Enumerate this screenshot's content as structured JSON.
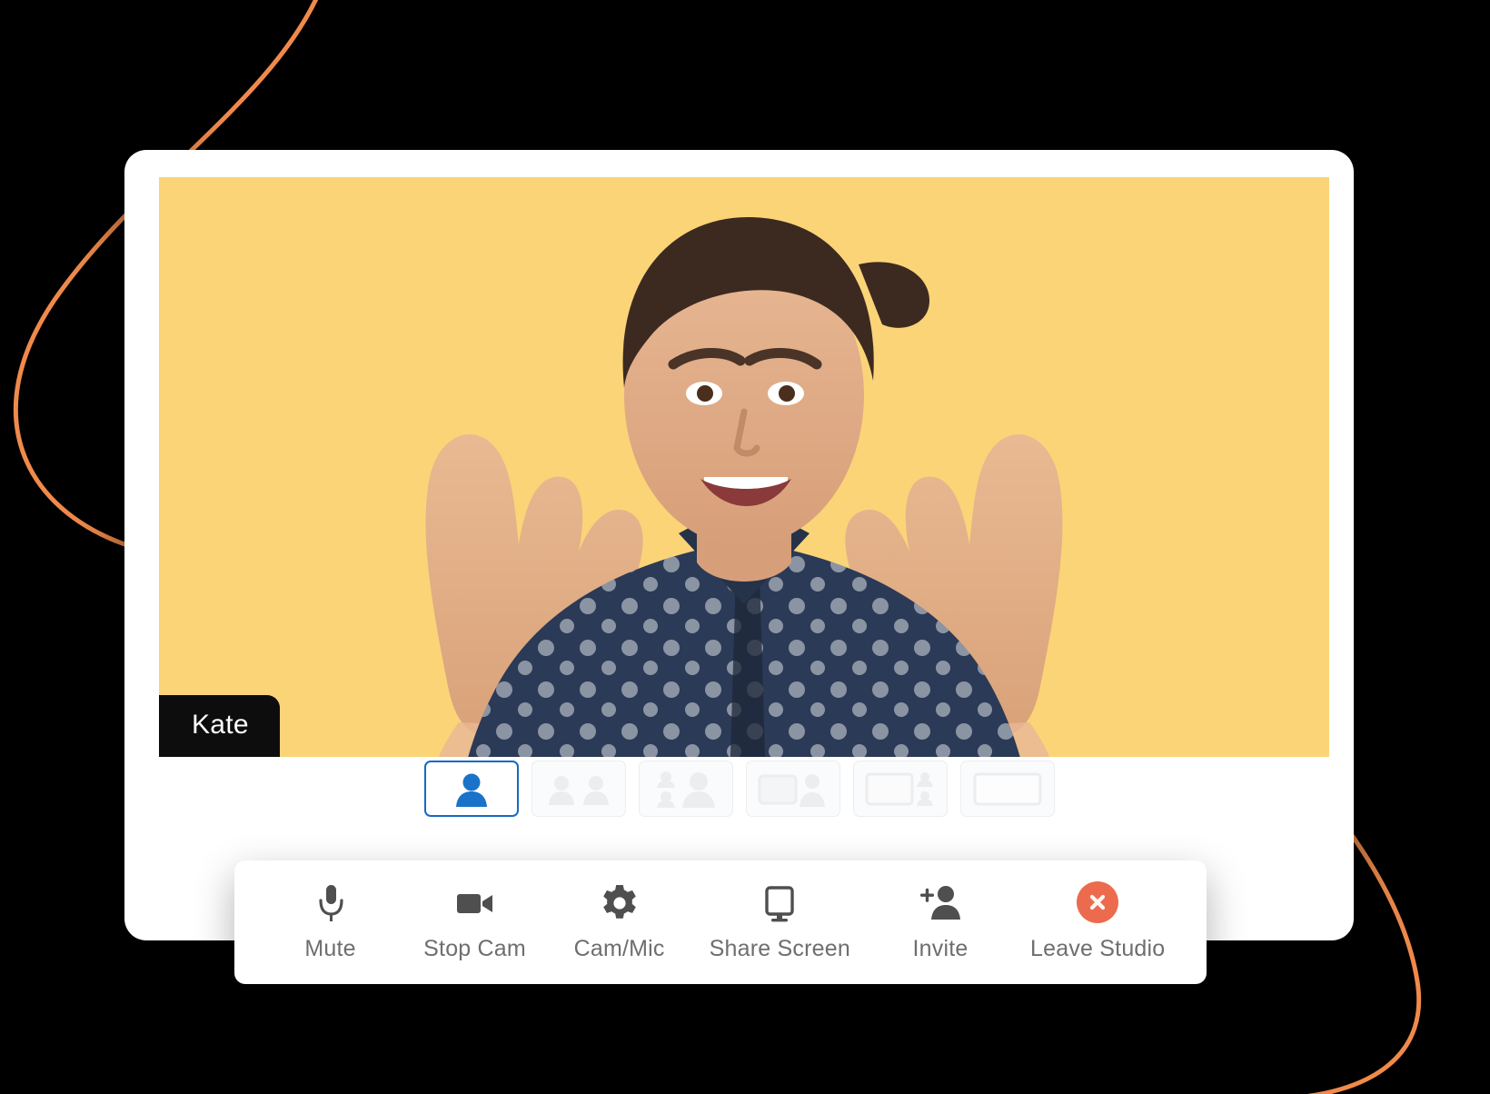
{
  "app": {
    "participant_name": "Kate",
    "video_background_color": "#FBD477",
    "accent_blue": "#1669c5",
    "leave_button_color": "#EC6B4E",
    "decor_curve_color": "#F08A4B",
    "card_background": "#FFFFFF"
  },
  "layout_selector": {
    "options": [
      {
        "id": "speaker-single",
        "icon": "single-person-icon",
        "selected": true
      },
      {
        "id": "two-up",
        "icon": "two-people-icon",
        "selected": false
      },
      {
        "id": "three-up",
        "icon": "three-people-icon",
        "selected": false
      },
      {
        "id": "screen-plus-person",
        "icon": "screen-and-person-icon",
        "selected": false
      },
      {
        "id": "screen-sidebar",
        "icon": "screen-with-sidebar-icon",
        "selected": false
      },
      {
        "id": "screen-only",
        "icon": "screen-only-icon",
        "selected": false
      }
    ]
  },
  "toolbar": {
    "items": [
      {
        "id": "mute",
        "label": "Mute",
        "icon": "microphone-icon"
      },
      {
        "id": "stop-cam",
        "label": "Stop Cam",
        "icon": "video-camera-icon"
      },
      {
        "id": "cam-mic",
        "label": "Cam/Mic",
        "icon": "gear-icon"
      },
      {
        "id": "share-screen",
        "label": "Share Screen",
        "icon": "monitor-icon"
      },
      {
        "id": "invite",
        "label": "Invite",
        "icon": "person-add-icon"
      },
      {
        "id": "leave-studio",
        "label": "Leave Studio",
        "icon": "close-circle-icon"
      }
    ]
  }
}
